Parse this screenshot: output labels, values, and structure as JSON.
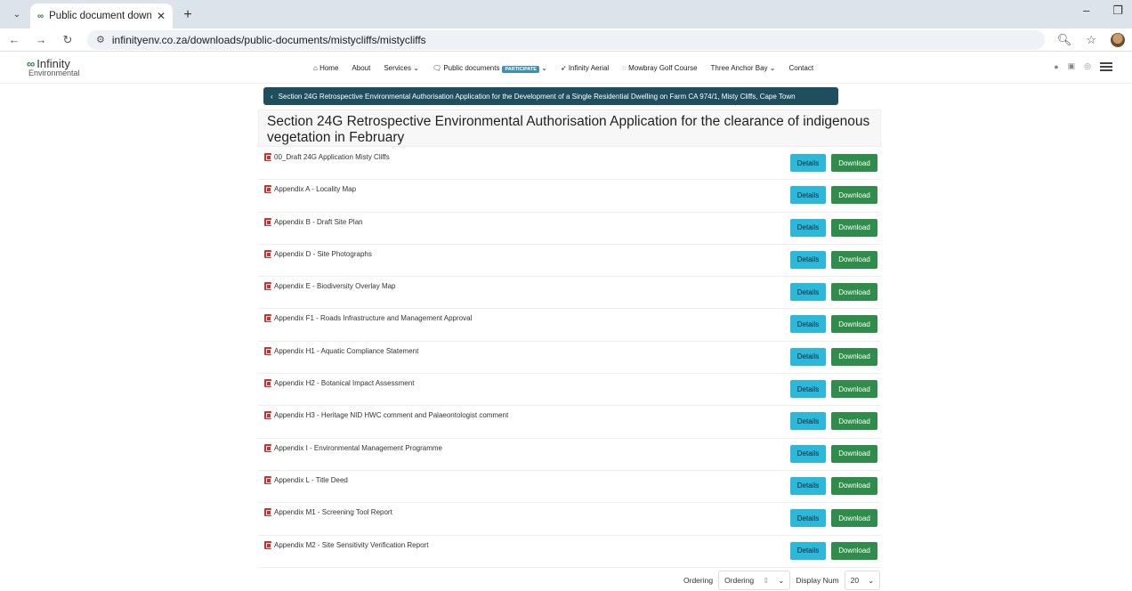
{
  "browser": {
    "tab_title": "Public document downloads (a",
    "url": "infinityenv.co.za/downloads/public-documents/mistycliffs/mistycliffs"
  },
  "site": {
    "logo_line1": "Infinity",
    "logo_line2": "Environmental",
    "menu": {
      "home": "Home",
      "about": "About",
      "services": "Services",
      "public_documents": "Public documents",
      "participate_badge": "PARTICIPATE",
      "infinity_aerial": "Infinity Aerial",
      "mowbray": "Mowbray Golf Course",
      "three_anchor": "Three Anchor Bay",
      "contact": "Contact"
    }
  },
  "back_button": "Section 24G Retrospective Environmental Authorisation Application for the Development of a Single Residential Dwelling on Farm CA 974/1, Misty Cliffs, Cape Town",
  "heading": "Section 24G Retrospective Environmental Authorisation Application for the clearance of indigenous vegetation in February",
  "button_labels": {
    "details": "Details",
    "download": "Download"
  },
  "documents": [
    "00_Draft 24G Application Misty Cliffs",
    "Appendix A - Locality Map",
    "Appendix B - Draft Site Plan",
    "Appendix D - Site Photographs",
    "Appendix E - Biodiversity Overlay Map",
    "Appendix F1 - Roads Infrastructure and Management Approval",
    "Appendix H1 - Aquatic Compliance Statement",
    "Appendix H2 - Botanical Impact Assessment",
    "Appendix H3 - Heritage NID HWC comment and Palaeontologist comment",
    "Appendix I - Environmental Management Programme",
    "Appendix L - Title Deed",
    "Appendix M1 - Screening Tool Report",
    "Appendix M2 - Site Sensitivity Verification Report"
  ],
  "footer": {
    "ordering_label": "Ordering",
    "ordering_value": "Ordering",
    "display_num_label": "Display Num",
    "display_num_value": "20"
  }
}
